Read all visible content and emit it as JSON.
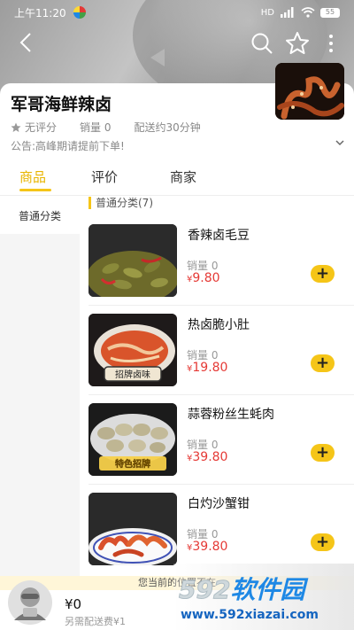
{
  "status_bar": {
    "time": "上午11:20",
    "signal": "HD",
    "battery": "55"
  },
  "shop": {
    "name": "军哥海鲜辣卤",
    "rating": "无评分",
    "sales": "销量 0",
    "delivery": "配送约30分钟",
    "notice": "公告:高峰期请提前下单!"
  },
  "tabs": [
    {
      "label": "商品"
    },
    {
      "label": "评价"
    },
    {
      "label": "商家"
    }
  ],
  "sidebar": {
    "items": [
      {
        "label": "普通分类"
      }
    ]
  },
  "category_title": "普通分类(7)",
  "products": [
    {
      "name": "香辣卤毛豆",
      "sales": "销量 0",
      "currency": "¥",
      "price": "9.80",
      "badge": ""
    },
    {
      "name": "热卤脆小肚",
      "sales": "销量 0",
      "currency": "¥",
      "price": "19.80",
      "badge": "招牌卤味"
    },
    {
      "name": "蒜蓉粉丝生蚝肉",
      "sales": "销量 0",
      "currency": "¥",
      "price": "39.80",
      "badge": "特色招牌"
    },
    {
      "name": "白灼沙蟹钳",
      "sales": "销量 0",
      "currency": "¥",
      "price": "39.80",
      "badge": ""
    }
  ],
  "add_label": "+",
  "location_notice": "您当前的位置不在",
  "cart": {
    "amount": "¥0",
    "fee": "另需配送费¥1"
  },
  "watermark": {
    "num": "592",
    "cn": "软件园",
    "url": "www.592xiazai.com"
  },
  "colors": {
    "accent": "#f5c518",
    "price": "#e53935",
    "tab_active": "#e8b500"
  }
}
